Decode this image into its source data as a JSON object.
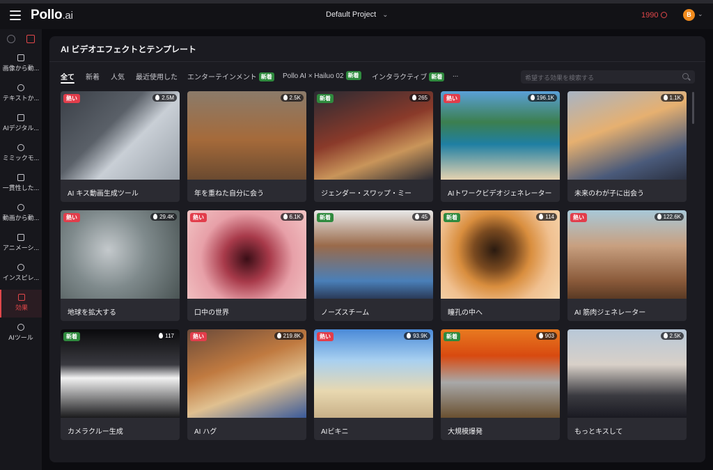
{
  "topbar": {
    "logo": "Pollo",
    "logo_suffix": ".ai",
    "project": "Default Project",
    "credits": "1990",
    "avatar_initial": "B",
    "accent": "#e2474a"
  },
  "sidebar": {
    "items": [
      {
        "label": "画像から動...",
        "icon": "image-to-video-icon"
      },
      {
        "label": "テキストか...",
        "icon": "text-to-video-icon"
      },
      {
        "label": "AIデジタル...",
        "icon": "ai-avatar-icon"
      },
      {
        "label": "ミミックモ...",
        "icon": "mimic-motion-icon"
      },
      {
        "label": "一貫性した...",
        "icon": "consistent-character-icon"
      },
      {
        "label": "動画から動...",
        "icon": "video-to-video-icon"
      },
      {
        "label": "アニメーシ...",
        "icon": "animation-icon"
      },
      {
        "label": "インスピレ...",
        "icon": "inspiration-icon"
      },
      {
        "label": "効果",
        "icon": "effects-icon",
        "active": true
      },
      {
        "label": "AIツール",
        "icon": "ai-tools-icon"
      }
    ]
  },
  "main": {
    "title": "AI ビデオエフェクトとテンプレート",
    "tabs": [
      {
        "label": "全て",
        "active": true
      },
      {
        "label": "新着"
      },
      {
        "label": "人気"
      },
      {
        "label": "最近使用した"
      },
      {
        "label": "エンターテインメント",
        "badge": "新着"
      },
      {
        "label": "Pollo AI × Hailuo 02",
        "badge": "新着"
      },
      {
        "label": "インタラクティブ",
        "badge": "新着"
      },
      {
        "label": "..."
      }
    ],
    "search_placeholder": "希望する効果を検索する",
    "cards": [
      {
        "title": "AI キス動画生成ツール",
        "badge": "熱い",
        "badge_type": "hot",
        "count": "2.5M"
      },
      {
        "title": "年を重ねた自分に会う",
        "badge": "",
        "badge_type": "",
        "count": "2.5K"
      },
      {
        "title": "ジェンダー・スワップ・ミー",
        "badge": "新着",
        "badge_type": "new",
        "count": "265"
      },
      {
        "title": "AIトワークビデオジェネレーター",
        "badge": "熱い",
        "badge_type": "hot",
        "count": "196.1K"
      },
      {
        "title": "未来のわが子に出会う",
        "badge": "",
        "badge_type": "",
        "count": "1.1K"
      },
      {
        "title": "地球を拡大する",
        "badge": "熱い",
        "badge_type": "hot",
        "count": "29.4K"
      },
      {
        "title": "口中の世界",
        "badge": "熱い",
        "badge_type": "hot",
        "count": "6.1K"
      },
      {
        "title": "ノーズスチーム",
        "badge": "新着",
        "badge_type": "new",
        "count": "45"
      },
      {
        "title": "瞳孔の中へ",
        "badge": "新着",
        "badge_type": "new",
        "count": "114"
      },
      {
        "title": "AI 筋肉ジェネレーター",
        "badge": "熱い",
        "badge_type": "hot",
        "count": "122.6K"
      },
      {
        "title": "カメラクルー生成",
        "badge": "新着",
        "badge_type": "new",
        "count": "117"
      },
      {
        "title": "AI ハグ",
        "badge": "熱い",
        "badge_type": "hot",
        "count": "219.8K"
      },
      {
        "title": "AIビキニ",
        "badge": "熱い",
        "badge_type": "hot",
        "count": "93.9K"
      },
      {
        "title": "大規模爆発",
        "badge": "新着",
        "badge_type": "new",
        "count": "903"
      },
      {
        "title": "もっとキスして",
        "badge": "",
        "badge_type": "",
        "count": "2.5K"
      }
    ]
  }
}
